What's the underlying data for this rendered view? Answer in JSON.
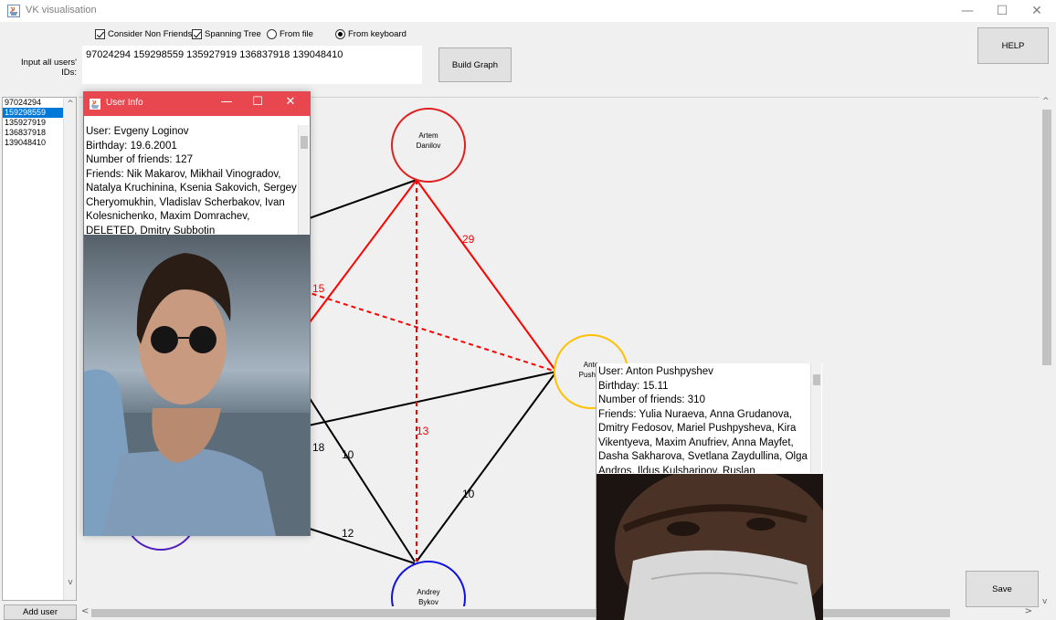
{
  "window": {
    "title": "VK visualisation"
  },
  "options": {
    "consider_non_friends": "Consider Non Friends",
    "spanning_tree": "Spanning Tree",
    "from_file": "From file",
    "from_keyboard": "From keyboard"
  },
  "input": {
    "label": "Input all users' IDs:",
    "value": "97024294 159298559 135927919 136837918 139048410"
  },
  "buttons": {
    "build_graph": "Build Graph",
    "help": "HELP",
    "save": "Save",
    "add_user": "Add user"
  },
  "id_list": [
    "97024294",
    "159298559",
    "135927919",
    "136837918",
    "139048410"
  ],
  "selected_id": "159298559",
  "graph": {
    "nodes": [
      {
        "id": "artem",
        "label_line1": "Artem",
        "label_line2": "Danilov",
        "color": "#e02020"
      },
      {
        "id": "anton",
        "label_line1": "Anto",
        "label_line2": "Pushpy",
        "color": "#ffc000"
      },
      {
        "id": "andrey",
        "label_line1": "Andrey",
        "label_line2": "Bykov",
        "color": "#1010e0"
      }
    ],
    "edge_labels": {
      "e29": "29",
      "e15": "15",
      "e13": "13",
      "e18": "18",
      "e10a": "10",
      "e10b": "10",
      "e12": "12"
    },
    "colors": {
      "tree": "#ff0000",
      "edge": "#000000"
    }
  },
  "user_info": {
    "title": "User Info",
    "user": "User: Evgeny Loginov",
    "birthday": "Birthday: 19.6.2001",
    "friends_count": "Number of friends: 127",
    "friends": "Friends: Nik Makarov, Mikhail Vinogradov, Natalya Kruchinina, Ksenia Sakovich, Sergey Cheryomukhin, Vladislav Scherbakov, Ivan Kolesnichenko, Maxim Domrachev, DELETED, Dmitry Subbotin"
  },
  "user_info_2": {
    "user": "User: Anton Pushpyshev",
    "birthday": "Birthday: 15.11",
    "friends_count": "Number of friends: 310",
    "friends": "Friends: Yulia Nuraeva, Anna Grudanova, Dmitry Fedosov, Mariel Pushpysheva, Kira Vikentyeva, Maxim Anufriev, Anna Mayfet, Dasha Sakharova, Svetlana Zaydullina, Olga Andros, Ildus Kulsharipov, Ruslan"
  }
}
